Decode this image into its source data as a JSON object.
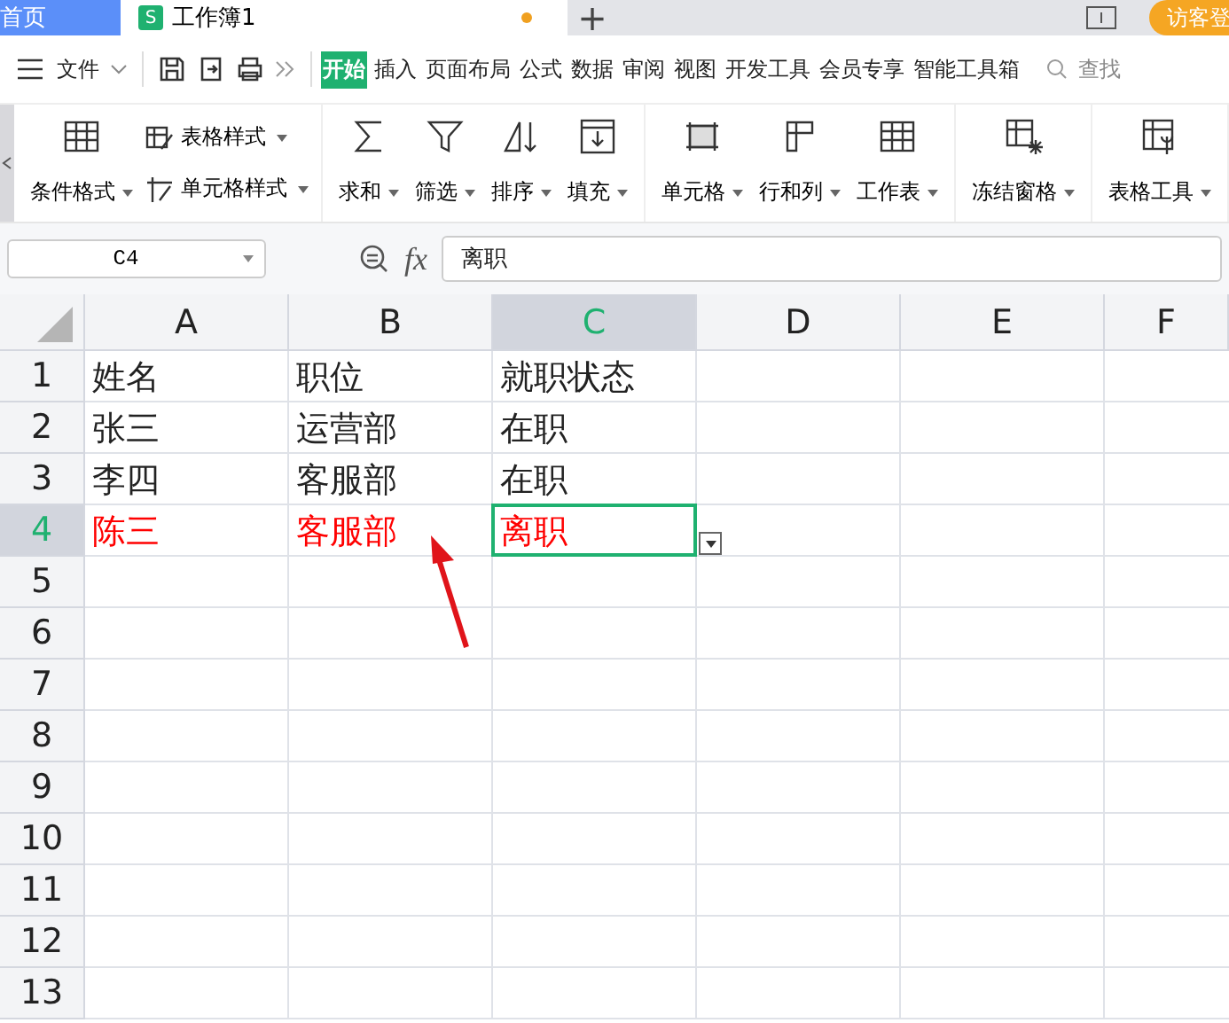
{
  "tabs": [
    {
      "label": "首页",
      "kind": "home",
      "selected": false
    },
    {
      "label": "工作簿1",
      "kind": "doc",
      "selected": true,
      "unsaved": true,
      "badge": "S"
    }
  ],
  "new_tab": "+",
  "function_label": "fx",
  "login_button": "访客登",
  "menu": {
    "file": "文件",
    "items": [
      {
        "label": "开始",
        "selected": true
      },
      {
        "label": "插入",
        "selected": false
      },
      {
        "label": "页面布局",
        "selected": false
      },
      {
        "label": "公式",
        "selected": false
      },
      {
        "label": "数据",
        "selected": false
      },
      {
        "label": "审阅",
        "selected": false
      },
      {
        "label": "视图",
        "selected": false
      },
      {
        "label": "开发工具",
        "selected": false
      },
      {
        "label": "会员专享",
        "selected": false
      },
      {
        "label": "智能工具箱",
        "selected": false
      }
    ],
    "search": "查找"
  },
  "ribbon": {
    "groups": [
      [
        {
          "label": "条件格式",
          "kind": "big"
        },
        {
          "kind": "stack",
          "items": [
            {
              "label": "表格样式"
            },
            {
              "label": "单元格样式"
            }
          ]
        }
      ],
      [
        {
          "label": "求和",
          "kind": "big"
        },
        {
          "label": "筛选",
          "kind": "big"
        },
        {
          "label": "排序",
          "kind": "big"
        },
        {
          "label": "填充",
          "kind": "big"
        }
      ],
      [
        {
          "label": "单元格",
          "kind": "big"
        },
        {
          "label": "行和列",
          "kind": "big"
        },
        {
          "label": "工作表",
          "kind": "big"
        }
      ],
      [
        {
          "label": "冻结窗格",
          "kind": "big"
        }
      ],
      [
        {
          "label": "表格工具",
          "kind": "big"
        }
      ]
    ]
  },
  "name_box": "C4",
  "formula": "离职",
  "columns": [
    {
      "label": "A",
      "selected": false
    },
    {
      "label": "B",
      "selected": false
    },
    {
      "label": "C",
      "selected": true
    },
    {
      "label": "D",
      "selected": false
    },
    {
      "label": "E",
      "selected": false
    },
    {
      "label": "F",
      "selected": false
    }
  ],
  "rows": [
    {
      "label": "1",
      "selected": false,
      "cells": [
        {
          "text": "姓名"
        },
        {
          "text": "职位"
        },
        {
          "text": "就职状态"
        }
      ]
    },
    {
      "label": "2",
      "selected": false,
      "cells": [
        {
          "text": "张三"
        },
        {
          "text": "运营部"
        },
        {
          "text": "在职"
        }
      ]
    },
    {
      "label": "3",
      "selected": false,
      "cells": [
        {
          "text": "李四"
        },
        {
          "text": "客服部"
        },
        {
          "text": "在职"
        }
      ]
    },
    {
      "label": "4",
      "selected": true,
      "cells": [
        {
          "text": "陈三",
          "color": "#ff0000"
        },
        {
          "text": "客服部",
          "color": "#ff0000"
        },
        {
          "text": "离职",
          "color": "#ff0000",
          "active": true
        }
      ]
    },
    {
      "label": "5",
      "selected": false,
      "cells": []
    },
    {
      "label": "6",
      "selected": false,
      "cells": []
    },
    {
      "label": "7",
      "selected": false,
      "cells": []
    },
    {
      "label": "8",
      "selected": false,
      "cells": []
    },
    {
      "label": "9",
      "selected": false,
      "cells": []
    },
    {
      "label": "10",
      "selected": false,
      "cells": []
    },
    {
      "label": "11",
      "selected": false,
      "cells": []
    },
    {
      "label": "12",
      "selected": false,
      "cells": []
    },
    {
      "label": "13",
      "selected": false,
      "cells": []
    }
  ]
}
